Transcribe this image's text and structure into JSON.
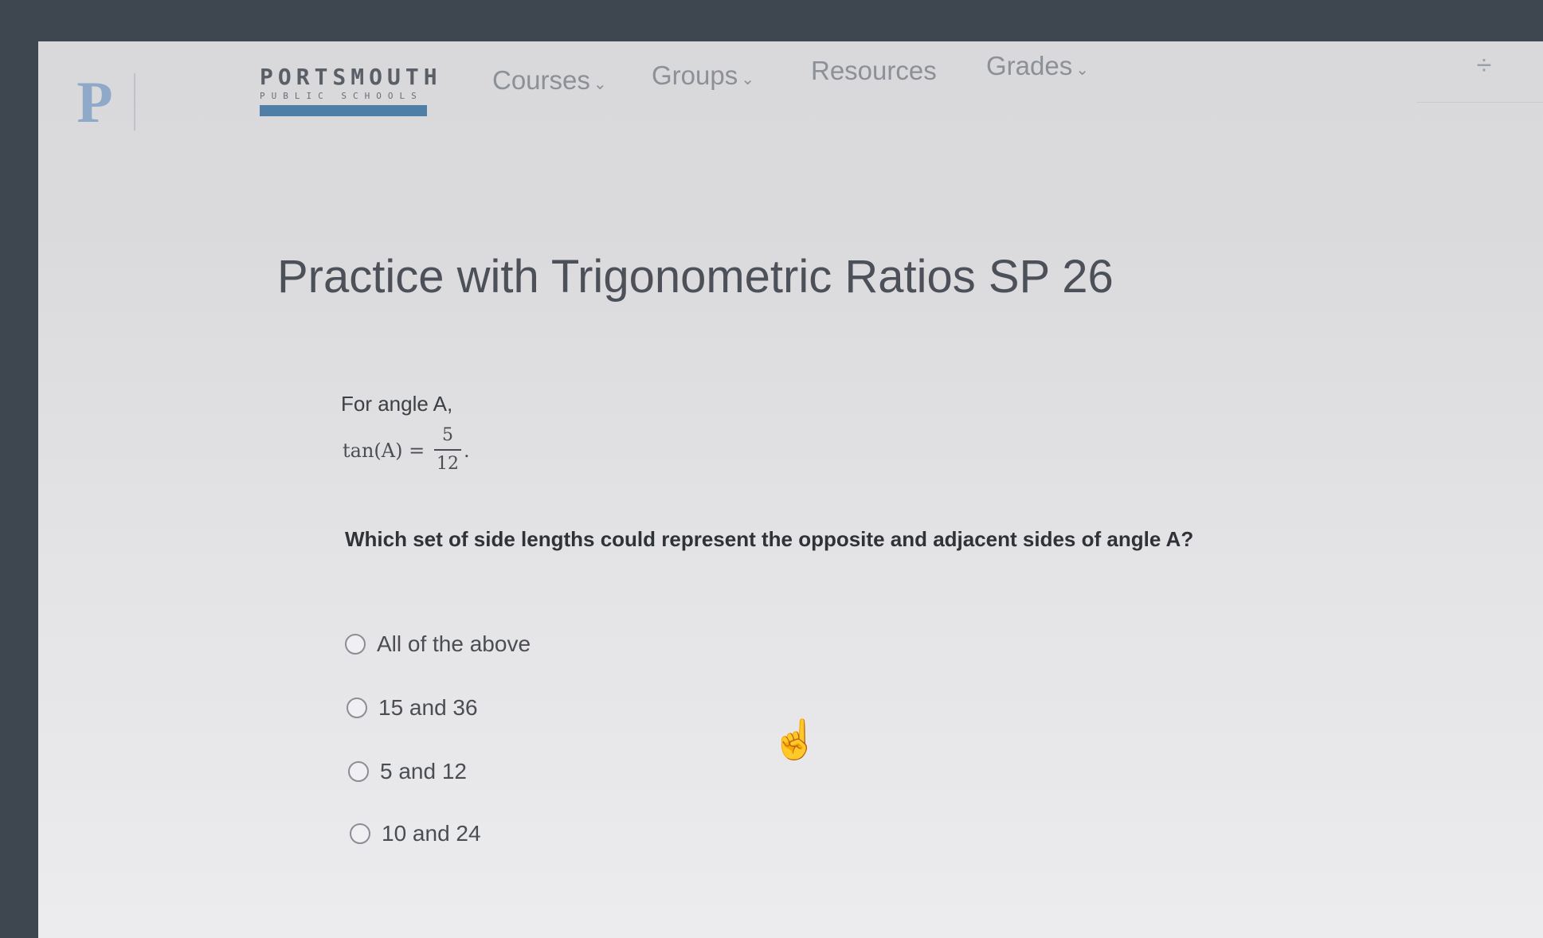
{
  "header": {
    "logo_letter": "P",
    "brand_name": "PORTSMOUTH",
    "brand_sub": "PUBLIC SCHOOLS",
    "nav": [
      {
        "label": "Courses",
        "has_dropdown": true
      },
      {
        "label": "Groups",
        "has_dropdown": true
      },
      {
        "label": "Resources",
        "has_dropdown": false
      },
      {
        "label": "Grades",
        "has_dropdown": true
      }
    ],
    "dropdown_glyph": "⌄",
    "corner_icon": "divide-icon"
  },
  "page": {
    "title": "Practice with Trigonometric Ratios SP 26"
  },
  "question": {
    "prompt": "For angle A,",
    "equation_lhs": "tan(A) =",
    "fraction_numerator": "5",
    "fraction_denominator": "12",
    "equation_end": ".",
    "text": "Which set of side lengths could represent the opposite and adjacent sides of angle A?",
    "options": [
      {
        "label": "All of the above",
        "selected": false
      },
      {
        "label": "15 and 36",
        "selected": false
      },
      {
        "label": "5 and 12",
        "selected": false
      },
      {
        "label": "10 and 24",
        "selected": false
      }
    ]
  },
  "colors": {
    "background": "#dadadc",
    "brand_bar": "#4f7fa6",
    "nav_text": "#8c9097",
    "title_text": "#4c5058"
  }
}
